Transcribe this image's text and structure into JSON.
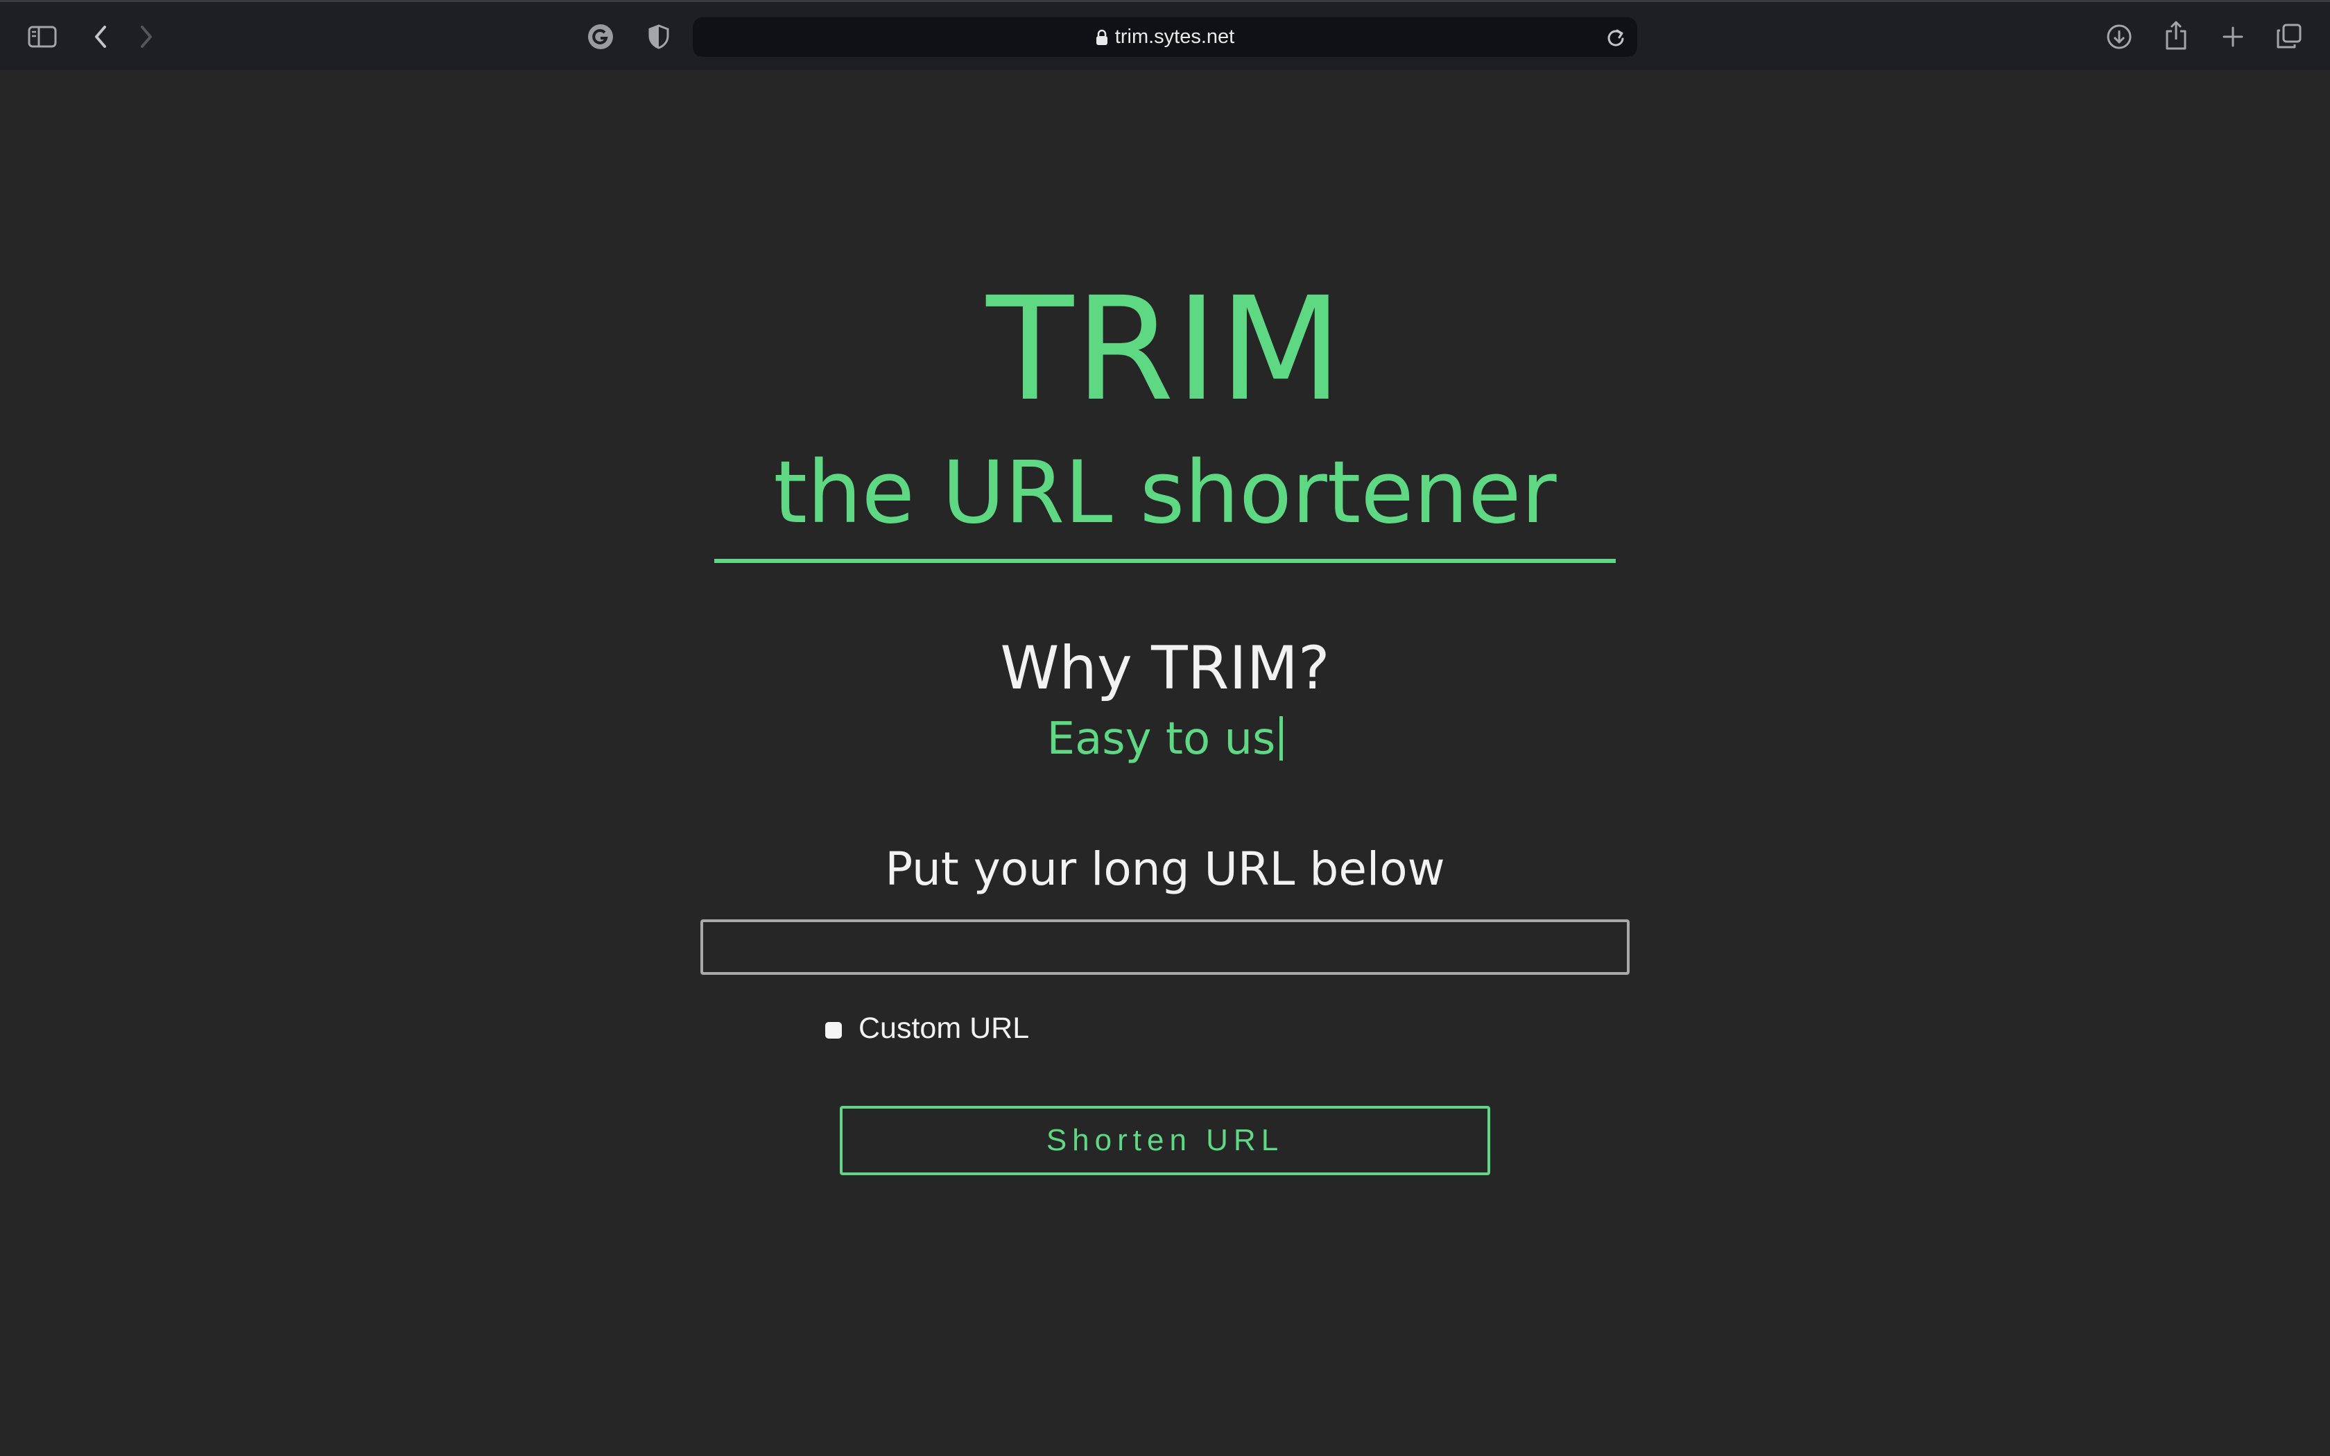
{
  "browser": {
    "url": "trim.sytes.net",
    "icons": {
      "sidebar": "sidebar-icon",
      "back": "chevron-left-icon",
      "forward": "chevron-right-icon",
      "extension_g": "grammarly-icon",
      "privacy": "shield-icon",
      "lock": "lock-icon",
      "reload": "reload-icon",
      "downloads": "download-icon",
      "share": "share-icon",
      "new_tab": "plus-icon",
      "tabs": "tab-overview-icon"
    }
  },
  "hero": {
    "title": "TRIM",
    "subtitle": "the URL shortener"
  },
  "why": {
    "heading": "Why TRIM?",
    "typed_text": "Easy to us"
  },
  "form": {
    "label": "Put your long URL below",
    "url_value": "",
    "url_placeholder": "",
    "custom_checkbox_label": "Custom URL",
    "custom_checked": false,
    "submit_label": "Shorten URL"
  },
  "colors": {
    "accent": "#5fd884",
    "background": "#262626",
    "toolbar": "#1e1f22",
    "text": "#f2f2f2"
  }
}
